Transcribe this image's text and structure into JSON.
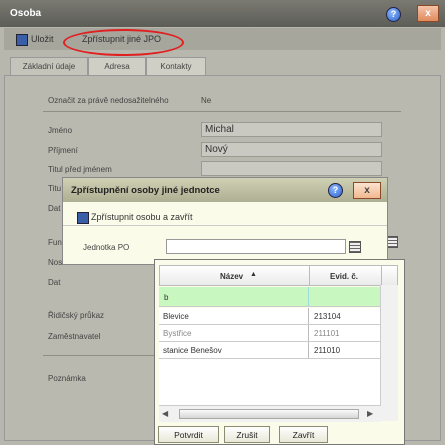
{
  "window": {
    "title": "Osoba",
    "help": "?",
    "close": "x"
  },
  "toolbar": {
    "save_label": "Uložit",
    "share_label": "Zpřístupnit jiné JPO"
  },
  "tabs": [
    {
      "label": "Základní údaje",
      "active": true
    },
    {
      "label": "Adresa",
      "active": false
    },
    {
      "label": "Kontakty",
      "active": false
    }
  ],
  "form": {
    "mark_label": "Označit za právě nedosažitelného",
    "mark_value": "Ne",
    "first_name_label": "Jméno",
    "first_name_value": "Michal",
    "last_name_label": "Příjmení",
    "last_name_value": "Nový",
    "title_before_label": "Titul před jménem",
    "title_after_label_partial": "Titu",
    "date_label_partial": "Dat",
    "function_label_partial": "Fun",
    "nos_label_partial": "Nos",
    "dat2_label_partial": "Dat",
    "license_label": "Řidičský průkaz",
    "employer_label": "Zaměstnavatel",
    "note_label": "Poznámka"
  },
  "modal": {
    "title": "Zpřístupnění osoby jiné jednotce",
    "help": "?",
    "close": "x",
    "share_and_close_label": "Zpřístupnit osobu a zavřít",
    "unit_label": "Jednotka PO",
    "unit_value": ""
  },
  "grid": {
    "columns": [
      "Název",
      "Evid. č."
    ],
    "sort_indicator": "▲",
    "filter_value": "b",
    "rows": [
      {
        "name": "Blevice",
        "id": "213104",
        "dim": false
      },
      {
        "name": "Bystřice",
        "id": "211101",
        "dim": true
      },
      {
        "name": "stanice Benešov",
        "id": "211010",
        "dim": false
      }
    ],
    "buttons": {
      "confirm": "Potvrdit",
      "cancel": "Zrušit",
      "close": "Zavřít"
    }
  },
  "colors": {
    "highlight_ellipse": "#e02020",
    "filter_row": "#c9f7c0"
  }
}
